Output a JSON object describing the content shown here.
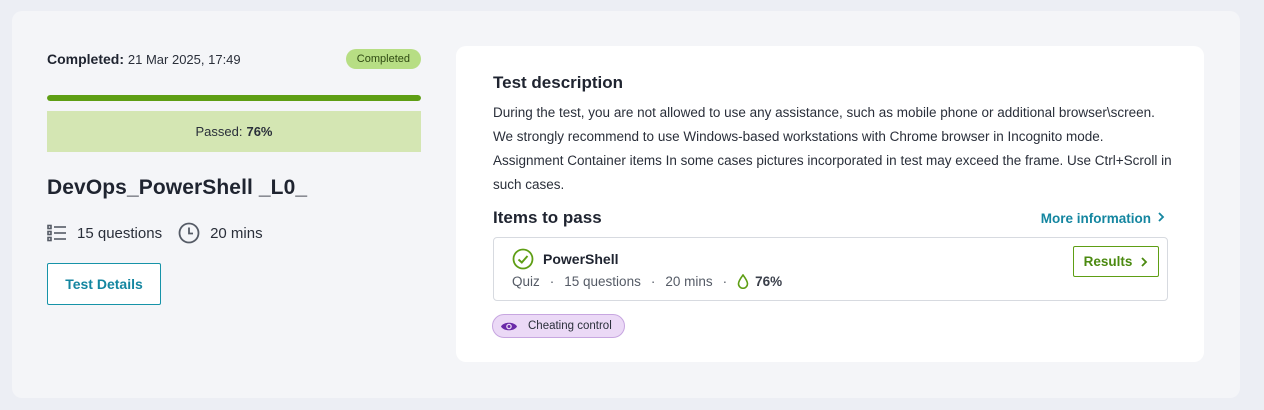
{
  "status": {
    "completed_label": "Completed:",
    "completed_date": "21 Mar 2025, 17:49",
    "badge": "Completed",
    "progress_percent": 100,
    "passed_label": "Passed:",
    "passed_value": "76%"
  },
  "test": {
    "title": "DevOps_PowerShell _L0_",
    "questions": "15 questions",
    "duration": "20 mins",
    "details_button": "Test Details"
  },
  "description": {
    "title": "Test description",
    "lines": [
      "During the test, you are not allowed to use any assistance, such as mobile phone or additional browser\\screen.",
      "We strongly recommend to use Windows-based workstations with Chrome browser in Incognito mode.",
      "Assignment Container items In some cases pictures incorporated in test may exceed the frame. Use Ctrl+Scroll in such cases."
    ]
  },
  "items": {
    "title": "Items to pass",
    "more_info": "More information",
    "list": [
      {
        "name": "PowerShell",
        "type": "Quiz",
        "questions": "15 questions",
        "duration": "20 mins",
        "score": "76%",
        "results_button": "Results"
      }
    ]
  },
  "cheating_control": "Cheating control",
  "colors": {
    "accent_teal": "#1486a0",
    "success_green": "#5e9e14",
    "badge_green": "#b7de84",
    "cheat_purple": "#6a2aa8"
  },
  "icons": {
    "questions": "list-icon",
    "duration": "clock-icon",
    "item_status": "check-circle-icon",
    "score": "drop-icon",
    "cheating": "eye-icon"
  }
}
